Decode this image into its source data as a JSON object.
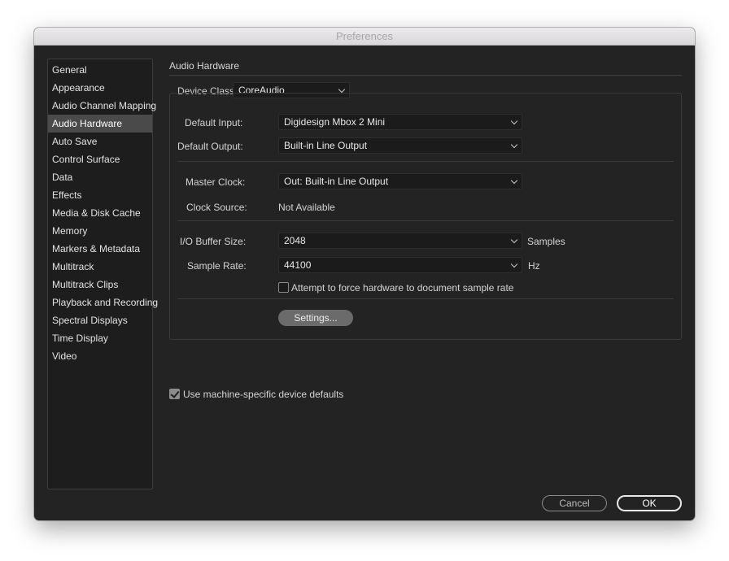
{
  "window": {
    "title": "Preferences"
  },
  "sidebar": {
    "items": [
      {
        "label": "General",
        "selected": false
      },
      {
        "label": "Appearance",
        "selected": false
      },
      {
        "label": "Audio Channel Mapping",
        "selected": false
      },
      {
        "label": "Audio Hardware",
        "selected": true
      },
      {
        "label": "Auto Save",
        "selected": false
      },
      {
        "label": "Control Surface",
        "selected": false
      },
      {
        "label": "Data",
        "selected": false
      },
      {
        "label": "Effects",
        "selected": false
      },
      {
        "label": "Media & Disk Cache",
        "selected": false
      },
      {
        "label": "Memory",
        "selected": false
      },
      {
        "label": "Markers & Metadata",
        "selected": false
      },
      {
        "label": "Multitrack",
        "selected": false
      },
      {
        "label": "Multitrack Clips",
        "selected": false
      },
      {
        "label": "Playback and Recording",
        "selected": false
      },
      {
        "label": "Spectral Displays",
        "selected": false
      },
      {
        "label": "Time Display",
        "selected": false
      },
      {
        "label": "Video",
        "selected": false
      }
    ]
  },
  "audio_hardware": {
    "section_title": "Audio Hardware",
    "device_class": {
      "label": "Device Class:",
      "value": "CoreAudio"
    },
    "default_input": {
      "label": "Default Input:",
      "value": "Digidesign Mbox 2 Mini"
    },
    "default_output": {
      "label": "Default Output:",
      "value": "Built-in Line Output"
    },
    "master_clock": {
      "label": "Master Clock:",
      "value": "Out: Built-in Line Output"
    },
    "clock_source": {
      "label": "Clock Source:",
      "value": "Not Available"
    },
    "io_buffer_size": {
      "label": "I/O Buffer Size:",
      "value": "2048",
      "unit": "Samples"
    },
    "sample_rate": {
      "label": "Sample Rate:",
      "value": "44100",
      "unit": "Hz"
    },
    "force_sample_rate": {
      "label": "Attempt to force hardware to document sample rate",
      "checked": false
    },
    "settings_button": "Settings...",
    "machine_defaults": {
      "label": "Use machine-specific device defaults",
      "checked": true
    }
  },
  "footer": {
    "cancel_label": "Cancel",
    "ok_label": "OK"
  }
}
